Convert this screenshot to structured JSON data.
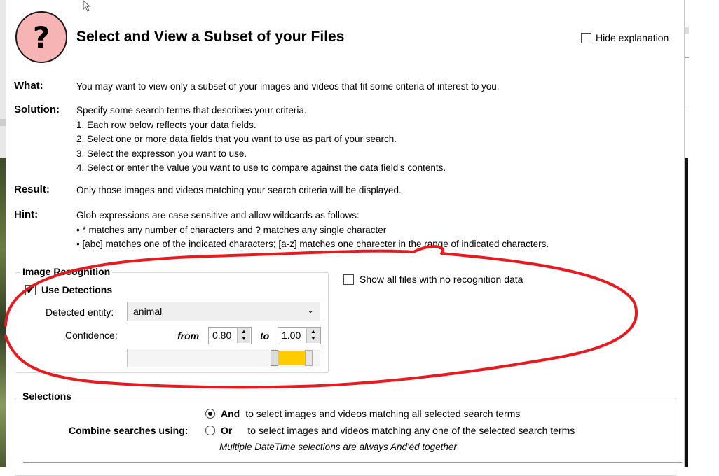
{
  "dialog": {
    "title": "Select and View a Subset of your Files",
    "help_glyph": "?",
    "hide_explanation_label": "Hide explanation",
    "hide_explanation_checked": false
  },
  "explanation": {
    "what_label": "What:",
    "what_text": "You may want to view only a subset of your images and videos that fit some criteria of interest to you.",
    "solution_label": "Solution:",
    "solution_lines": [
      "Specify some search terms that describes your criteria.",
      "1. Each row below reflects your data fields.",
      "2. Select one or more data fields that you want to use as part of your search.",
      "3. Select the expresson you want to use.",
      "4. Select or enter the value you want to use to compare against the data field's contents."
    ],
    "result_label": "Result:",
    "result_text": "Only those images and videos matching your search criteria will be displayed.",
    "hint_label": "Hint:",
    "hint_lines": [
      "Glob expressions are case sensitive and allow wildcards as follows:",
      "• * matches any number of characters and ? matches any single character",
      "• [abc] matches one of the indicated characters; [a-z] matches one charecter in the range of indicated characters."
    ]
  },
  "image_recognition": {
    "group_title": "Image Recognition",
    "use_detections_label": "Use Detections",
    "use_detections_checked": true,
    "check_glyph": "✔",
    "detected_entity_label": "Detected entity:",
    "detected_entity_value": "animal",
    "dropdown_glyph": "⌄",
    "confidence_label": "Confidence:",
    "from_label": "from",
    "from_value": "0.80",
    "to_label": "to",
    "to_value": "1.00",
    "spin_up_glyph": "▲",
    "spin_down_glyph": "▼",
    "range_low": 0.8,
    "range_high": 1.0,
    "range_color": "#ffcc00",
    "show_all_label": "Show all files with no recognition data",
    "show_all_checked": false
  },
  "selections": {
    "group_title": "Selections",
    "combine_label": "Combine searches using:",
    "and_label": "And",
    "and_desc": "to select images and videos matching all selected search terms",
    "and_selected": true,
    "or_label": "Or",
    "or_desc": "to select images and videos matching any one of the selected search terms",
    "or_selected": false,
    "note": "Multiple DateTime selections are always And'ed together"
  },
  "colors": {
    "help_icon_fill": "#f7b4b4",
    "annotation_red": "#e8191f"
  }
}
